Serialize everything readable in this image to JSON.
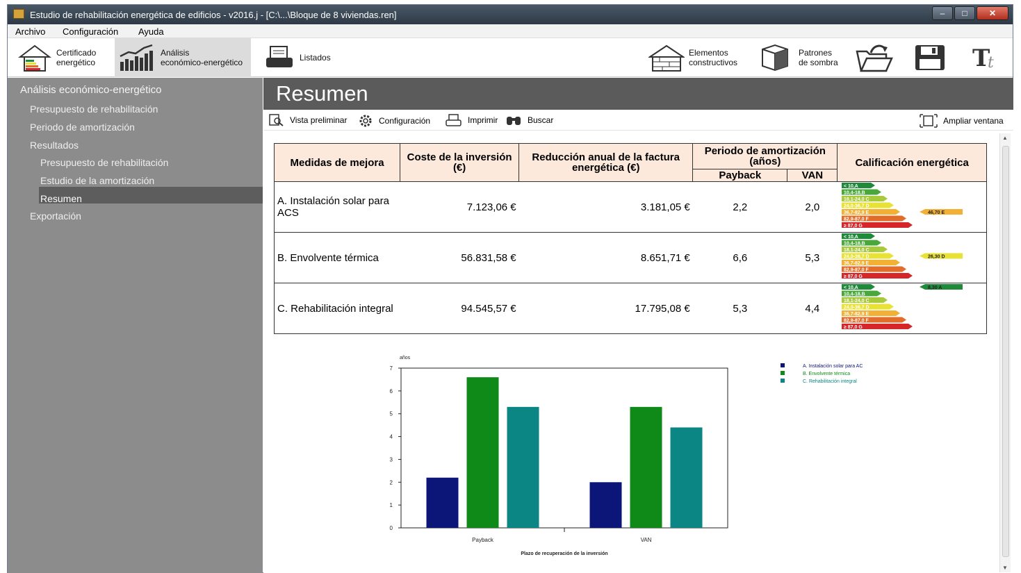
{
  "window": {
    "title": "Estudio de rehabilitación energética de edificios - v2016.j - [C:\\...\\Bloque de 8 viviendas.ren]"
  },
  "menu": [
    "Archivo",
    "Configuración",
    "Ayuda"
  ],
  "toolbar": {
    "certificado": [
      "Certificado",
      "energético"
    ],
    "analisis": [
      "Análisis",
      "económico-energético"
    ],
    "listados": "Listados",
    "elementos": [
      "Elementos",
      "constructivos"
    ],
    "patrones": [
      "Patrones",
      "de sombra"
    ]
  },
  "sidebar": {
    "header": "Análisis económico-energético",
    "items": [
      "Presupuesto de rehabilitación",
      "Periodo de amortización",
      "Resultados",
      "Presupuesto de rehabilitación",
      "Estudio de la amortización",
      "Resumen",
      "Exportación"
    ]
  },
  "page": {
    "title": "Resumen"
  },
  "subtoolbar": {
    "vista": "Vista preliminar",
    "config": "Configuración",
    "imprimir": "Imprimir",
    "buscar": "Buscar",
    "ampliar": "Ampliar ventana"
  },
  "table": {
    "headers": {
      "medidas": "Medidas de mejora",
      "coste": "Coste de la inversión (€)",
      "reduccion": "Reducción anual de la factura energética (€)",
      "periodo": "Periodo de amortización (años)",
      "payback": "Payback",
      "van": "VAN",
      "calificacion": "Calificación energética"
    },
    "rows": [
      {
        "medida": "A. Instalación solar para ACS",
        "coste": "7.123,06 €",
        "reduccion": "3.181,05 €",
        "payback": "2,2",
        "van": "2,0",
        "rating": "46,70 E"
      },
      {
        "medida": "B. Envolvente térmica",
        "coste": "56.831,58 €",
        "reduccion": "8.651,71 €",
        "payback": "6,6",
        "van": "5,3",
        "rating": "26,30 D"
      },
      {
        "medida": "C. Rehabilitación integral",
        "coste": "94.545,57 €",
        "reduccion": "17.795,08 €",
        "payback": "5,3",
        "van": "4,4",
        "rating": "8,30 A"
      }
    ],
    "scale_labels": [
      "< 10,A",
      "10,4-18,B",
      "18,1-24,0 C",
      "24,0-36,7 D",
      "36,7-82,9 E",
      "82,9-87,0 F",
      "≥ 87,0 G"
    ],
    "scale_colors": [
      "#1e8a3a",
      "#4aa83b",
      "#a7c93c",
      "#e9e236",
      "#f2b134",
      "#e26d2a",
      "#d5262a"
    ]
  },
  "chart_data": {
    "type": "bar",
    "ylabel": "años",
    "xlabel": "Plazo de recuperación de la inversión",
    "categories": [
      "Payback",
      "VAN"
    ],
    "ylim": [
      0,
      7
    ],
    "yticks": [
      0,
      1,
      2,
      3,
      4,
      5,
      6,
      7
    ],
    "series": [
      {
        "name": "A. Instalación solar para AC",
        "values": [
          2.2,
          2.0
        ],
        "color": "#0c1678"
      },
      {
        "name": "B. Envolvente térmica",
        "values": [
          6.6,
          5.3
        ],
        "color": "#0f8a18"
      },
      {
        "name": "C. Rehabilitación integral",
        "values": [
          5.3,
          4.4
        ],
        "color": "#0c8585"
      }
    ],
    "legend": "top-right"
  }
}
